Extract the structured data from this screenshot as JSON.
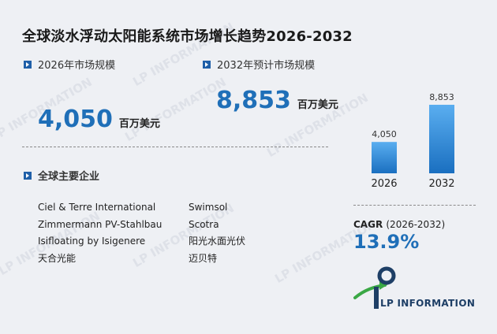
{
  "title": "全球淡水浮动太阳能系统市场增长趋势2026-2032",
  "market_2026": {
    "label": "2026年市场规模",
    "value": "4,050",
    "unit": "百万美元"
  },
  "market_2032": {
    "label": "2032年预计市场规模",
    "value": "8,853",
    "unit": "百万美元"
  },
  "companies_section": {
    "label": "全球主要企业",
    "left": [
      "Ciel & Terre International",
      "Zimmermann PV-Stahlbau",
      "Isifloating by Isigenere",
      "天合光能"
    ],
    "right": [
      "Swimsol",
      "Scotra",
      "阳光水面光伏",
      "迈贝特"
    ]
  },
  "cagr": {
    "label": "CAGR",
    "years": "(2026-2032)",
    "value": "13.9%"
  },
  "brand": {
    "name": "LP INFORMATION",
    "watermark": "LP INFORMATION"
  },
  "colors": {
    "accent": "#1f6fb8",
    "bar_top": "#5aaef0",
    "bar_bottom": "#1a6fc0",
    "logo_green": "#3aa845",
    "logo_navy": "#1e3f66"
  },
  "chart_data": {
    "type": "bar",
    "categories": [
      "2026",
      "2032"
    ],
    "values": [
      4050,
      8853
    ],
    "data_labels": [
      "4,050",
      "8,853"
    ],
    "ylim": [
      0,
      8853
    ],
    "grid": false,
    "title": "",
    "xlabel": "",
    "ylabel": ""
  }
}
